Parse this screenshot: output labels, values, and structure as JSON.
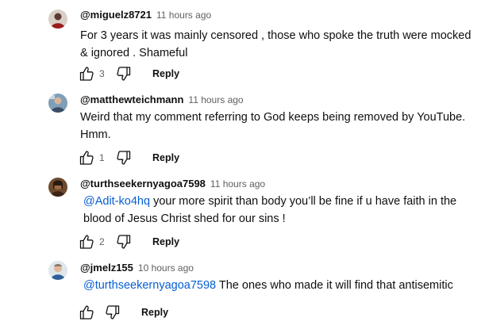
{
  "comments": [
    {
      "handle": "@miguelz8721",
      "time": "11 hours ago",
      "mention": "",
      "text": "For 3 years it was mainly censored , those who spoke the truth were mocked & ignored . Shameful",
      "likes": "3",
      "reply_label": "Reply"
    },
    {
      "handle": "@matthewteichmann",
      "time": "11 hours ago",
      "mention": "",
      "text": "Weird that my comment referring to God keeps being removed by YouTube. Hmm.",
      "likes": "1",
      "reply_label": "Reply"
    },
    {
      "handle": "@turthseekernyagoa7598",
      "time": "11 hours ago",
      "mention": "@Adit-ko4hq",
      "text": " your more spirit than body you’ll be fine if u have faith in the blood of Jesus Christ shed for our sins !",
      "likes": "2",
      "reply_label": "Reply"
    },
    {
      "handle": "@jmelz155",
      "time": "10 hours ago",
      "mention": "@turthseekernyagoa7598",
      "text": " The ones who made it will find that antisemitic",
      "likes": "",
      "reply_label": "Reply"
    }
  ],
  "icons": {
    "like": "thumb-up-icon",
    "dislike": "thumb-down-icon"
  },
  "colors": {
    "mention": "#065fd4",
    "secondary_text": "#606060"
  }
}
